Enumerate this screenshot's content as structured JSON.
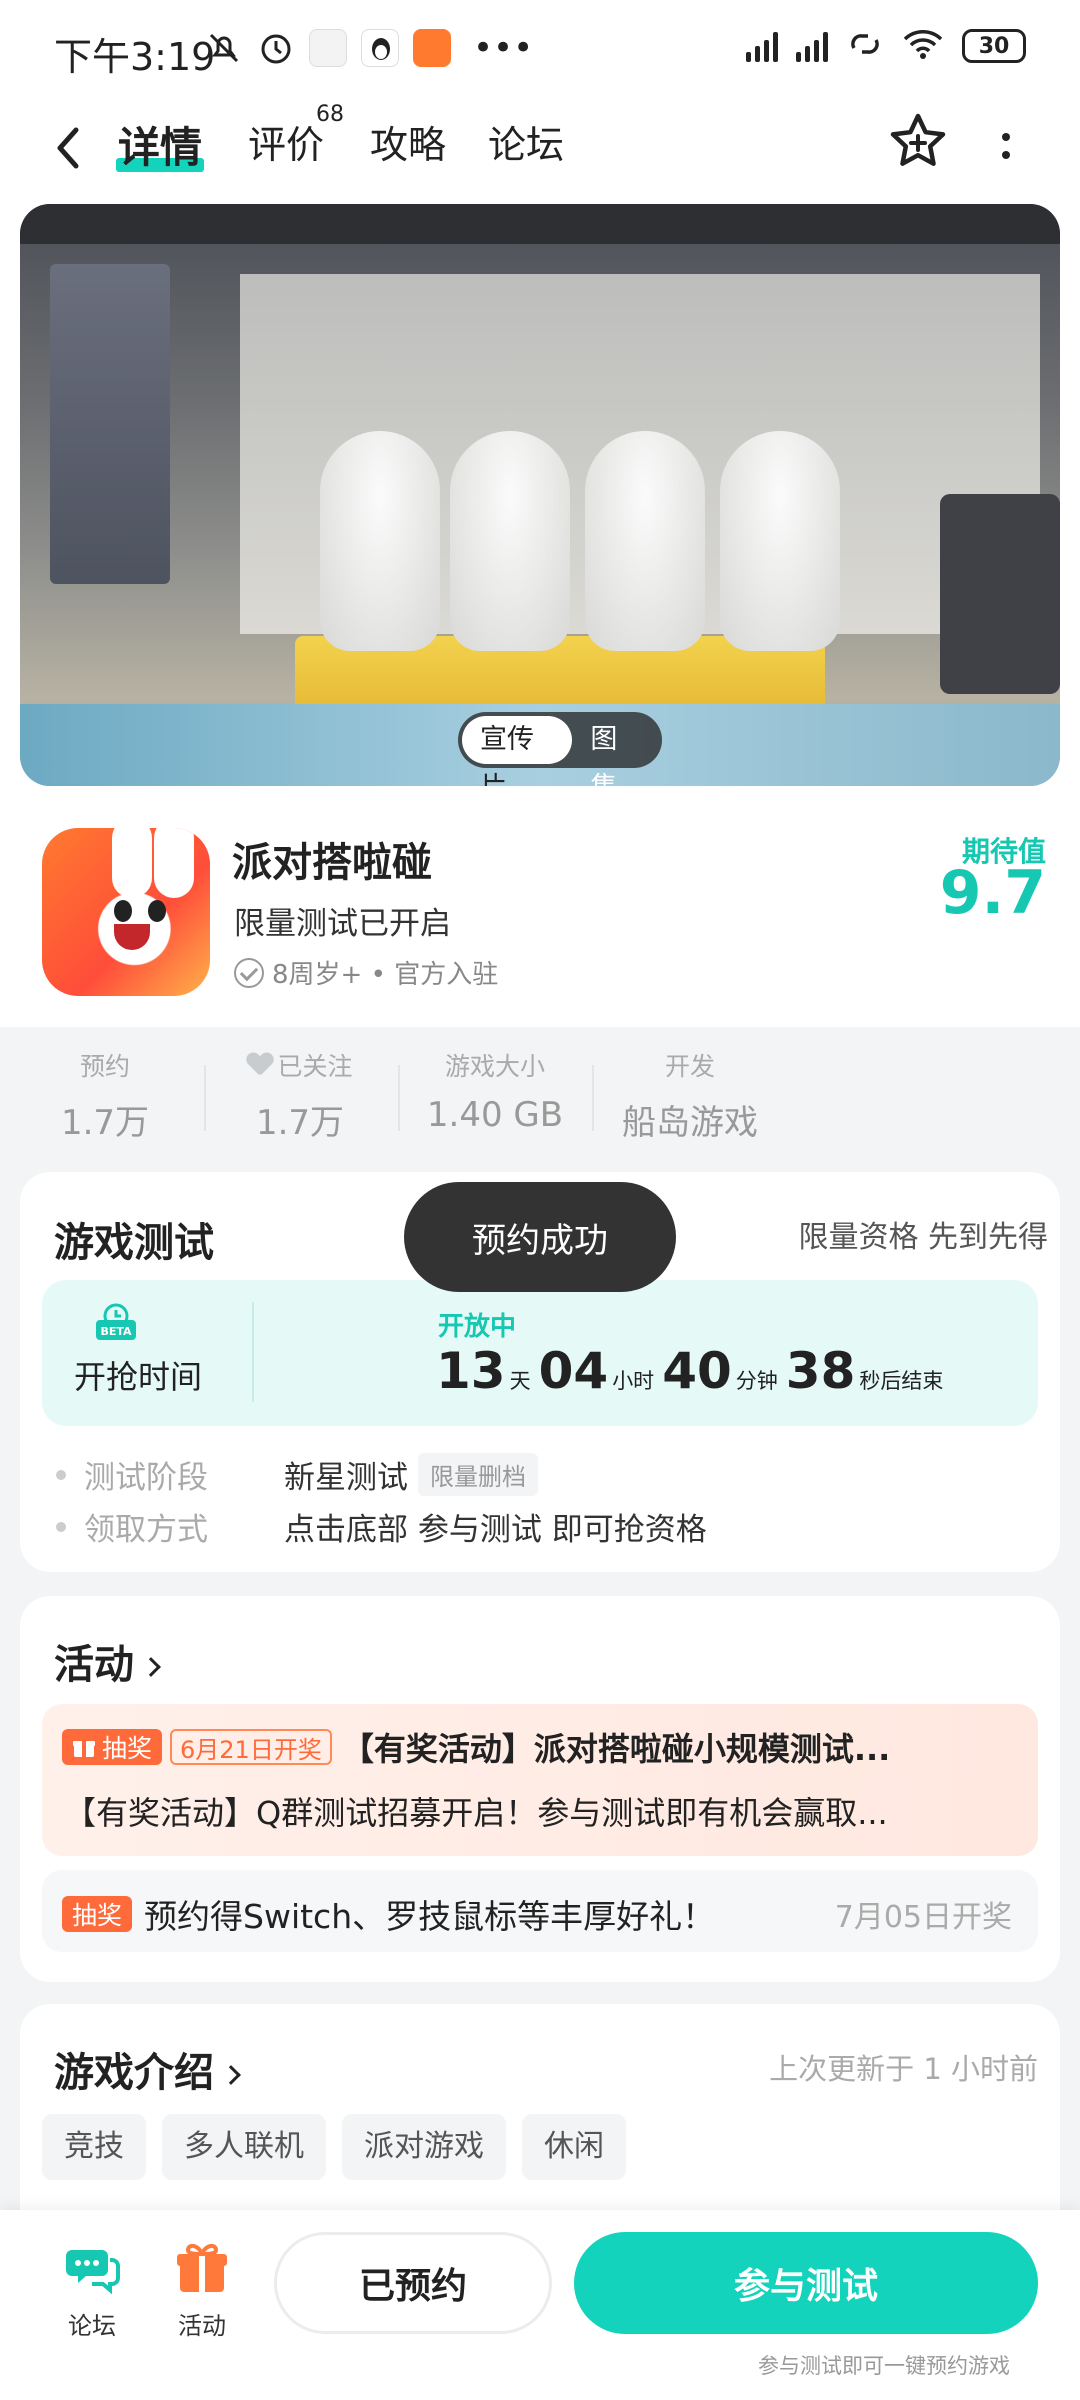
{
  "status_bar": {
    "time": "下午3:19",
    "battery": "30"
  },
  "nav": {
    "tabs": [
      {
        "label": "详情",
        "active": true
      },
      {
        "label": "评价",
        "badge": "68"
      },
      {
        "label": "攻略"
      },
      {
        "label": "论坛"
      }
    ]
  },
  "hero": {
    "tabs": [
      "宣传片",
      "图集"
    ]
  },
  "game": {
    "name": "派对搭啦碰",
    "subtitle": "限量测试已开启",
    "meta": "8周岁+ • 官方入驻",
    "expect_label": "期待值",
    "expect_value": "9.7"
  },
  "stats": [
    {
      "label": "预约",
      "value": "1.7万"
    },
    {
      "label": "已关注",
      "value": "1.7万"
    },
    {
      "label": "游戏大小",
      "value": "1.40 GB"
    },
    {
      "label": "开发",
      "value": "船岛游戏"
    }
  ],
  "test": {
    "title": "游戏测试",
    "tag": "限量资格 先到先得",
    "toast": "预约成功",
    "timer_label": "开抢时间",
    "open_label": "开放中",
    "countdown": {
      "days": "13",
      "days_unit": "天",
      "hours": "04",
      "hours_unit": "小时",
      "minutes": "40",
      "minutes_unit": "分钟",
      "seconds": "38",
      "seconds_unit": "秒后结束"
    },
    "rows": [
      {
        "key": "测试阶段",
        "value": "新星测试",
        "chip": "限量删档"
      },
      {
        "key": "领取方式",
        "value": "点击底部 参与测试 即可抢资格"
      }
    ]
  },
  "activity": {
    "title": "活动",
    "big": {
      "tag": "抽奖",
      "date_tag": "6月21日开奖",
      "title": "【有奖活动】派对搭啦碰小规模测试...",
      "desc": "【有奖活动】Q群测试招募开启！参与测试即有机会赢取..."
    },
    "small": {
      "tag": "抽奖",
      "text": "预约得Switch、罗技鼠标等丰厚好礼！",
      "date": "7月05日开奖"
    }
  },
  "intro": {
    "title": "游戏介绍",
    "updated": "上次更新于 1 小时前",
    "tags": [
      "竞技",
      "多人联机",
      "派对游戏",
      "休闲"
    ]
  },
  "bottom": {
    "forum": "论坛",
    "activity": "活动",
    "reserved": "已预约",
    "join": "参与测试",
    "hint": "参与测试即可一键预约游戏"
  },
  "colors": {
    "accent": "#14d3bd",
    "lottery": "#ff6a3a"
  }
}
